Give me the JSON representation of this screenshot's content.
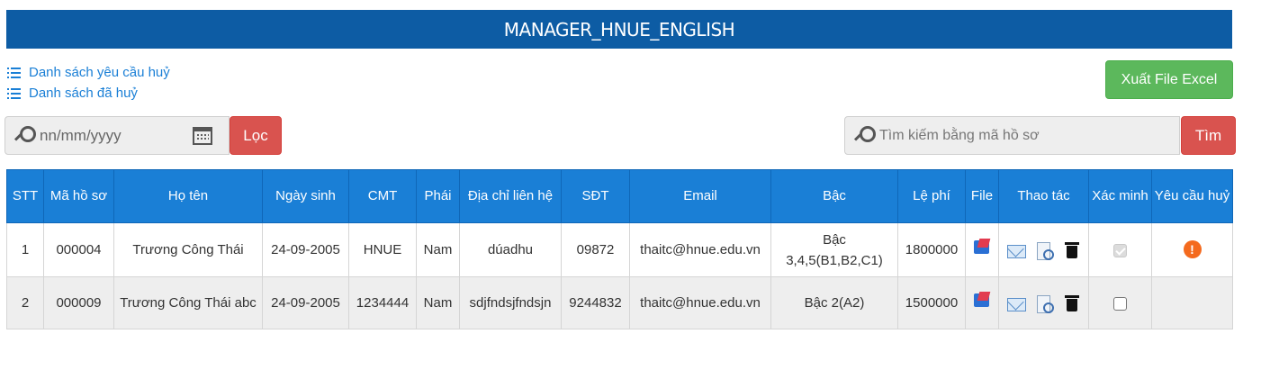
{
  "header": {
    "title": "MANAGER_HNUE_ENGLISH"
  },
  "links": [
    {
      "label": "Danh sách yêu cầu huỷ"
    },
    {
      "label": "Danh sách đã huỷ"
    }
  ],
  "export_button": "Xuất File Excel",
  "date_filter": {
    "placeholder": "nn/mm/yyyy",
    "button": "Lọc"
  },
  "search": {
    "placeholder": "Tìm kiếm bằng mã hồ sơ",
    "button": "Tìm"
  },
  "table": {
    "headers": [
      "STT",
      "Mã hồ sơ",
      "Họ tên",
      "Ngày sinh",
      "CMT",
      "Phái",
      "Địa chỉ liên hệ",
      "SĐT",
      "Email",
      "Bậc",
      "Lệ phí",
      "File",
      "Thao tác",
      "Xác minh",
      "Yêu cầu huỷ"
    ],
    "rows": [
      {
        "stt": "1",
        "ma_ho_so": "000004",
        "ho_ten": "Trương Công Thái",
        "ngay_sinh": "24-09-2005",
        "cmt": "HNUE",
        "phai": "Nam",
        "dia_chi": "dúadhu",
        "sdt": "09872",
        "email": "thaitc@hnue.edu.vn",
        "bac": "Bậc 3,4,5(B1,B2,C1)",
        "le_phi": "1800000",
        "xac_minh": true,
        "xac_minh_disabled": true,
        "yeu_cau_huy": true,
        "warn_icon": "!"
      },
      {
        "stt": "2",
        "ma_ho_so": "000009",
        "ho_ten": "Trương Công Thái abc",
        "ngay_sinh": "24-09-2005",
        "cmt": "1234444",
        "phai": "Nam",
        "dia_chi": "sdjfndsjfndsjn",
        "sdt": "9244832",
        "email": "thaitc@hnue.edu.vn",
        "bac": "Bậc 2(A2)",
        "le_phi": "1500000",
        "xac_minh": false,
        "xac_minh_disabled": false,
        "yeu_cau_huy": false
      }
    ]
  },
  "colors": {
    "banner": "#0d5ca4",
    "table_header": "#1a7fd6",
    "link": "#1a7fd6",
    "export_button": "#5cb85c",
    "action_button": "#d9534f",
    "warning": "#f46a1e"
  }
}
